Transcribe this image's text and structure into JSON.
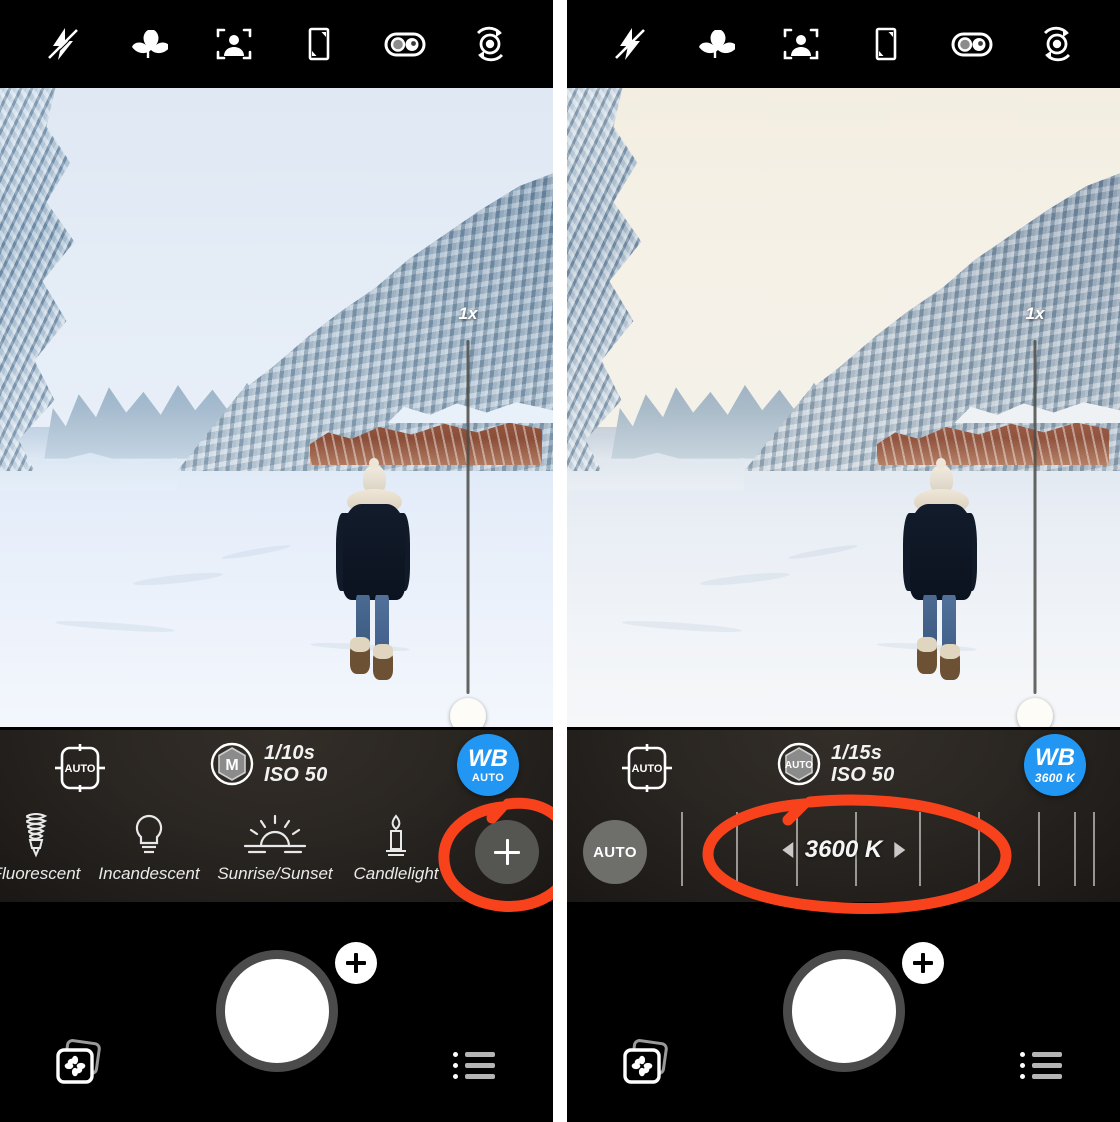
{
  "app": {
    "name": "camera-app",
    "accent_blue": "#2196f3",
    "annotation_color": "#f8421c",
    "panel_background": "#000000",
    "control_bar_background": "#2a2622"
  },
  "panels": [
    {
      "id": "left",
      "name": "auto-white-balance-panel",
      "topbar": {
        "icons": [
          {
            "name": "flash-off-icon",
            "label": "Flash Off"
          },
          {
            "name": "macro-icon",
            "label": "Macro"
          },
          {
            "name": "face-detect-icon",
            "label": "Face Detection"
          },
          {
            "name": "aspect-ratio-icon",
            "label": "Aspect Ratio"
          },
          {
            "name": "dual-lens-icon",
            "label": "Lens Select"
          },
          {
            "name": "flip-camera-icon",
            "label": "Flip Camera"
          }
        ]
      },
      "viewfinder": {
        "zoom_label": "1x",
        "scene": "snowy-river-forest-cool"
      },
      "status": {
        "focus_mode": "AUTO",
        "metering_mode": "M",
        "shutter_speed": "1/10s",
        "iso": "ISO 50",
        "wb_badge_main": "WB",
        "wb_badge_sub": "AUTO"
      },
      "presets": [
        {
          "name": "preset-fluorescent",
          "label": "Fluorescent",
          "icon": "fluorescent-bulb-icon"
        },
        {
          "name": "preset-incandescent",
          "label": "Incandescent",
          "icon": "light-bulb-icon"
        },
        {
          "name": "preset-sunrise-sunset",
          "label": "Sunrise/Sunset",
          "icon": "sun-horizon-icon"
        },
        {
          "name": "preset-candlelight",
          "label": "Candlelight",
          "icon": "candle-icon"
        }
      ],
      "add_preset_button": {
        "name": "add-custom-wb-button",
        "glyph": "+"
      },
      "annotation": {
        "shape": "ellipse",
        "target": "add-custom-wb-button"
      },
      "bottom": {
        "shutter_button": "shutter-button",
        "shutter_plus": "+",
        "gallery_button": "gallery-thumbnail-button",
        "menu_button": "settings-menu-button"
      }
    },
    {
      "id": "right",
      "name": "manual-kelvin-panel",
      "topbar": {
        "icons": [
          {
            "name": "flash-off-icon",
            "label": "Flash Off"
          },
          {
            "name": "macro-icon",
            "label": "Macro"
          },
          {
            "name": "face-detect-icon",
            "label": "Face Detection"
          },
          {
            "name": "aspect-ratio-icon",
            "label": "Aspect Ratio"
          },
          {
            "name": "dual-lens-icon",
            "label": "Lens Select"
          },
          {
            "name": "flip-camera-icon",
            "label": "Flip Camera"
          }
        ]
      },
      "viewfinder": {
        "zoom_label": "1x",
        "scene": "snowy-river-forest-warm"
      },
      "status": {
        "focus_mode": "AUTO",
        "metering_mode": "AUTO",
        "shutter_speed": "1/15s",
        "iso": "ISO 50",
        "wb_badge_main": "WB",
        "wb_badge_sub": "3600 K"
      },
      "temperature_slider": {
        "name": "kelvin-temperature-slider",
        "auto_button_label": "AUTO",
        "current_value": "3600 K",
        "decrement_arrow": "◀",
        "increment_arrow": "▶",
        "tick_positions_pct": [
          12,
          22,
          33,
          45,
          56,
          67,
          78,
          86,
          90
        ]
      },
      "annotation": {
        "shape": "ellipse",
        "target": "kelvin-temperature-value"
      },
      "bottom": {
        "shutter_button": "shutter-button",
        "shutter_plus": "+",
        "gallery_button": "gallery-thumbnail-button",
        "menu_button": "settings-menu-button"
      }
    }
  ]
}
